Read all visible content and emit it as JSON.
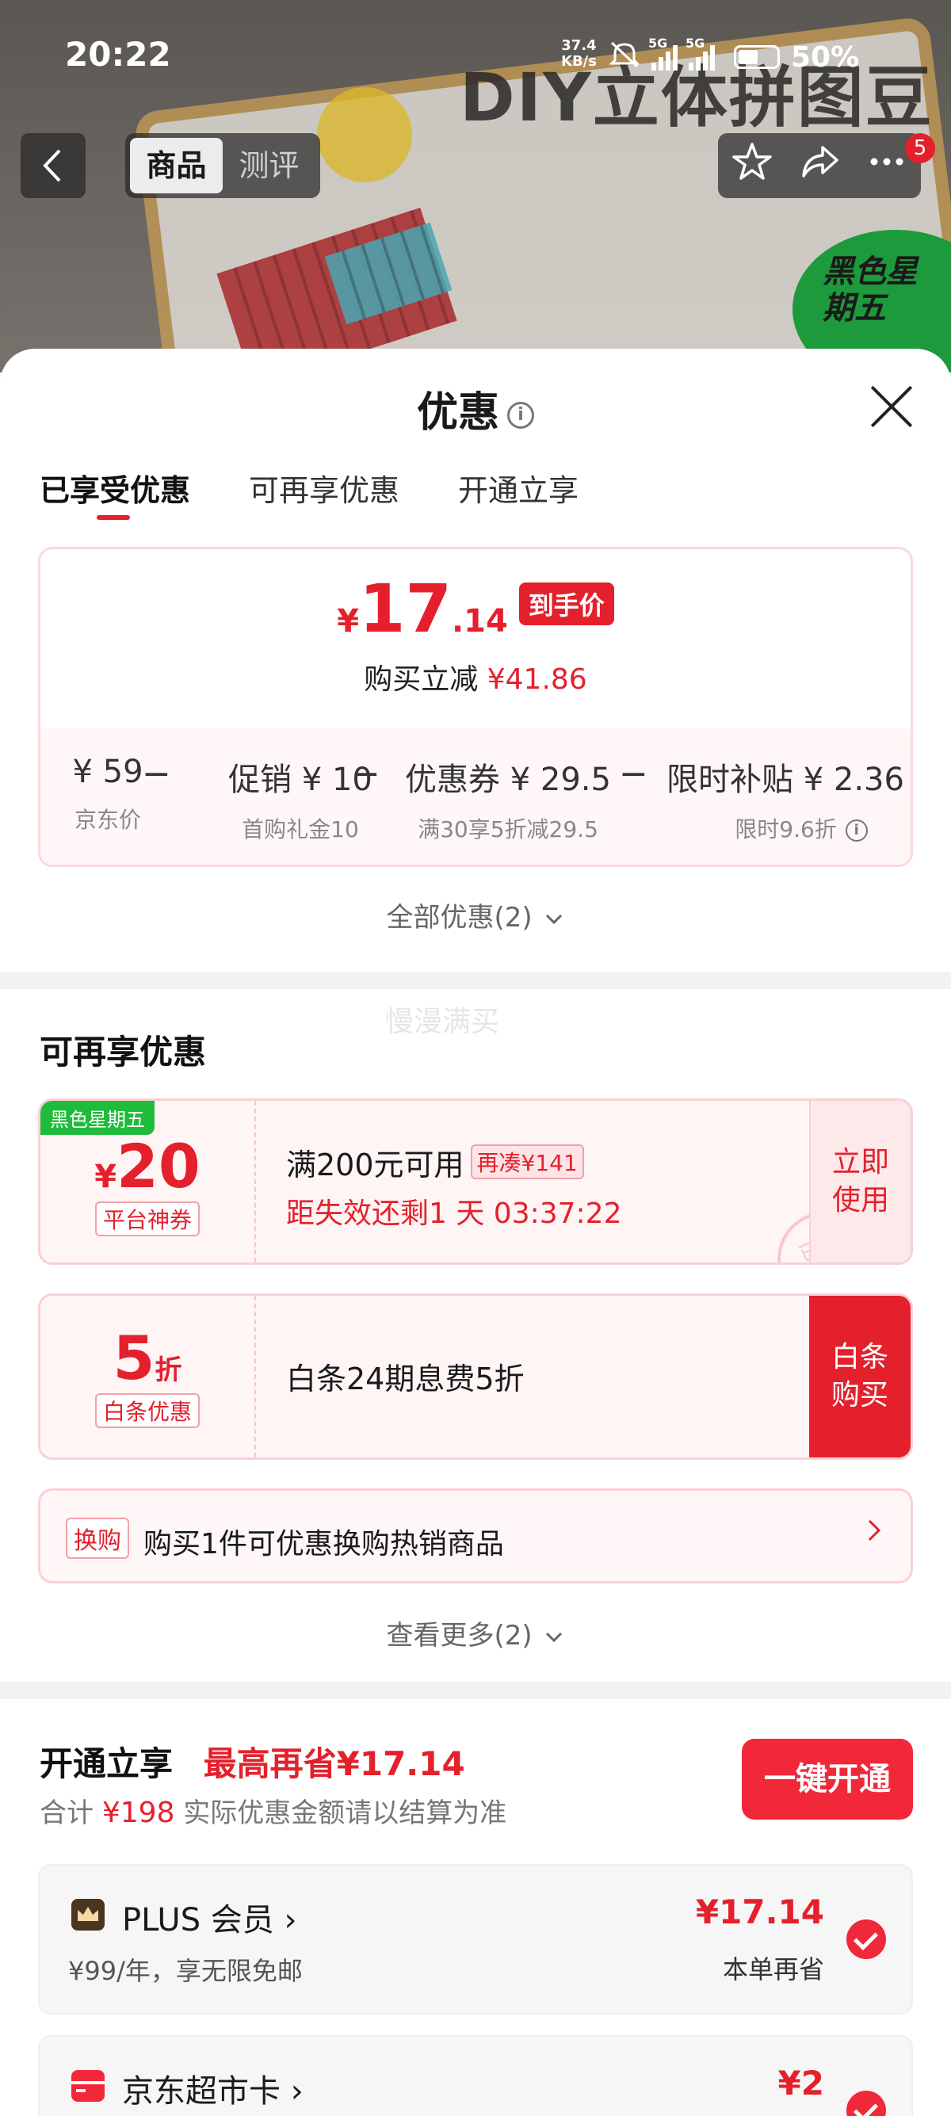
{
  "status_bar": {
    "time": "20:22",
    "net_speed_value": "37.4",
    "net_speed_unit": "KB/s",
    "sim1": "5G",
    "sim2": "5G",
    "battery": "50%"
  },
  "product_banner": {
    "title": "DIY立体拼图豆",
    "promo_badge": "黑色星期五"
  },
  "nav": {
    "back_icon": "chevron-left-icon",
    "tabs": [
      "商品",
      "测评"
    ],
    "active_tab": "商品",
    "notification_count": "5"
  },
  "sheet": {
    "title": "优惠",
    "tabs": [
      "已享受优惠",
      "可再享优惠",
      "开通立享"
    ],
    "active_tab": "已享受优惠"
  },
  "price_card": {
    "currency": "¥",
    "price_int": "17",
    "price_dec": ".14",
    "price_tag": "到手价",
    "reduce_label": "购买立减",
    "reduce_amount": "¥41.86",
    "breakdown": [
      {
        "value": "¥ 59",
        "sub": "京东价"
      },
      {
        "value": "促销 ¥ 10",
        "sub": "首购礼金10"
      },
      {
        "value": "优惠券 ¥ 29.5",
        "sub": "满30享5折减29.5"
      },
      {
        "value": "限时补贴 ¥ 2.36",
        "sub": "限时9.6折"
      }
    ],
    "operator": "−"
  },
  "all_discounts": "全部优惠(2)",
  "more_section": {
    "title": "可再享优惠",
    "watermark": "慢漫满买",
    "coupons": [
      {
        "ribbon": "黑色星期五",
        "currency": "¥",
        "amount": "20",
        "kind": "平台神券",
        "condition": "满200元可用",
        "tag": "再凑¥141",
        "countdown": "距失效还剩1 天 03:37:22",
        "action": "立即使用",
        "stamp": "已领"
      },
      {
        "amount": "5",
        "unit": "折",
        "kind": "白条优惠",
        "condition": "白条24期息费5折",
        "action": "白条购买"
      }
    ],
    "exchange_label": "换购",
    "exchange_text": "购买1件可优惠换购热销商品",
    "see_more": "查看更多(2)"
  },
  "membership": {
    "title": "开通立享",
    "max_save": "最高再省¥17.14",
    "total_label": "合计",
    "total_amount": "¥198",
    "note": "实际优惠金额请以结算为准",
    "open_button": "一键开通",
    "cards": [
      {
        "name": "PLUS 会员 ›",
        "desc": "¥99/年，享无限免邮",
        "price": "¥17.14",
        "save": "本单再省",
        "icon": "crown-icon"
      },
      {
        "name": "京东超市卡 ›",
        "desc": "",
        "price": "¥2",
        "save": "",
        "icon": "card-icon"
      }
    ]
  },
  "colors": {
    "accent_red": "#e4202c",
    "badge_green": "#1fbb3b"
  }
}
